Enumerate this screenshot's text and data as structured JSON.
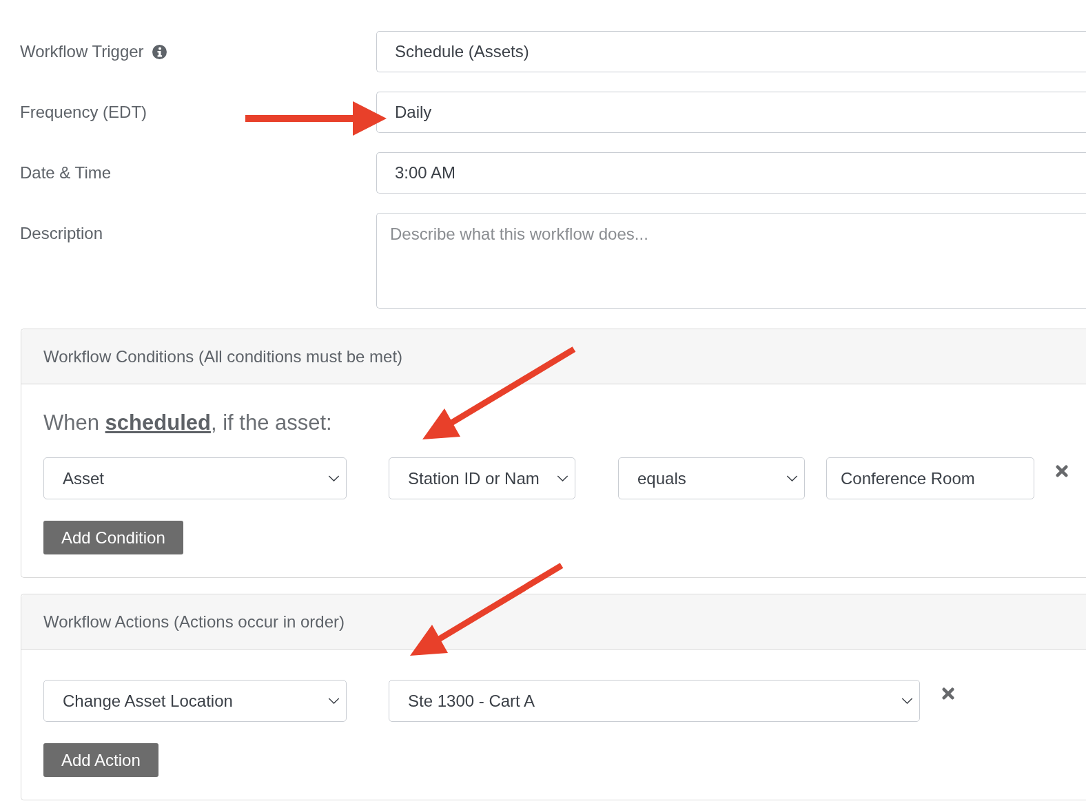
{
  "form": {
    "fields": [
      {
        "label": "Workflow Trigger",
        "info": true,
        "kind": "text",
        "value": "Schedule (Assets)",
        "arrow": false
      },
      {
        "label": "Frequency (EDT)",
        "info": false,
        "kind": "text",
        "value": "Daily",
        "arrow": true
      },
      {
        "label": "Date & Time",
        "info": false,
        "kind": "text",
        "value": "3:00 AM",
        "arrow": false
      },
      {
        "label": "Description",
        "info": false,
        "kind": "textarea",
        "placeholder": "Describe what this workflow does...",
        "arrow": false
      }
    ]
  },
  "panels": [
    {
      "title": "Workflow Conditions (All conditions must be met)",
      "intro": "When **scheduled**, if the asset:",
      "rows": [
        {
          "controls": [
            {
              "kind": "select",
              "value": "Asset",
              "arrow": false
            },
            {
              "kind": "select",
              "value": "Station ID or Nam",
              "arrow": true
            },
            {
              "kind": "select",
              "value": "equals",
              "arrow": false
            },
            {
              "kind": "input",
              "value": "Conference Room",
              "arrow": false
            }
          ],
          "removable": true
        }
      ],
      "add_button": "Add Condition"
    },
    {
      "title": "Workflow Actions (Actions occur in order)",
      "rows": [
        {
          "controls": [
            {
              "kind": "select",
              "value": "Change Asset Location",
              "arrow": false
            },
            {
              "kind": "select",
              "value": "Ste 1300 - Cart A",
              "arrow": true
            }
          ],
          "removable": true
        }
      ],
      "add_button": "Add Action"
    }
  ]
}
